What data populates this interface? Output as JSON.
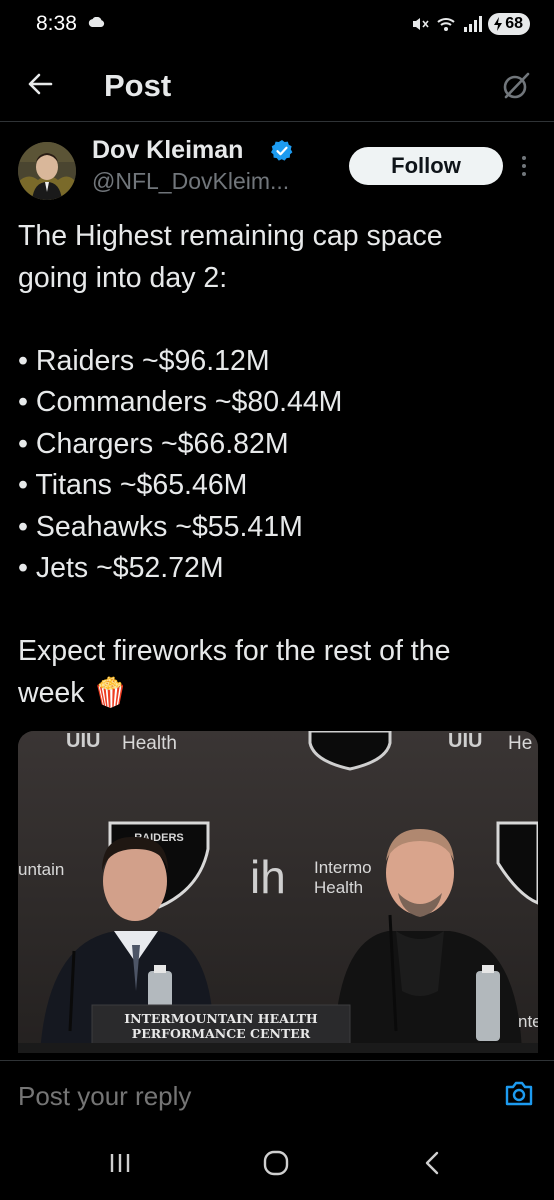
{
  "status_bar": {
    "time": "8:38",
    "battery": "68"
  },
  "header": {
    "title": "Post"
  },
  "author": {
    "name": "Dov Kleiman",
    "handle": "@NFL_DovKleim...",
    "verified": true,
    "follow_label": "Follow"
  },
  "post": {
    "line1": "The Highest remaining cap space",
    "line2": "going into day 2:",
    "bullets": [
      "• Raiders ~$96.12M",
      "• Commanders ~$80.44M",
      "• Chargers ~$66.82M",
      "• Titans ~$65.46M",
      "• Seahawks ~$55.41M",
      "• Jets ~$52.72M"
    ],
    "closing1": "Expect fireworks for the rest of the",
    "closing2": "week 🍿"
  },
  "media": {
    "backdrop_left_text": "Health",
    "backdrop_right_text": "He",
    "shield_text": "RAIDERS",
    "left_edge_text": "untain",
    "center_logo_line1": "Intermo",
    "center_logo_line2": "Health",
    "podium_line1": "INTERMOUNTAIN HEALTH",
    "podium_line2": "PERFORMANCE CENTER",
    "right_edge_text": "nte",
    "colors": {
      "backdrop": "#2e2a29",
      "shield": "#0b0b0b",
      "podium": "#2a2a2c"
    }
  },
  "reply": {
    "placeholder": "Post your reply"
  },
  "colors": {
    "background": "#000000",
    "text": "#e7e9ea",
    "muted": "#71767b",
    "verified_blue": "#1d9bf0",
    "divider": "#2f3336"
  }
}
